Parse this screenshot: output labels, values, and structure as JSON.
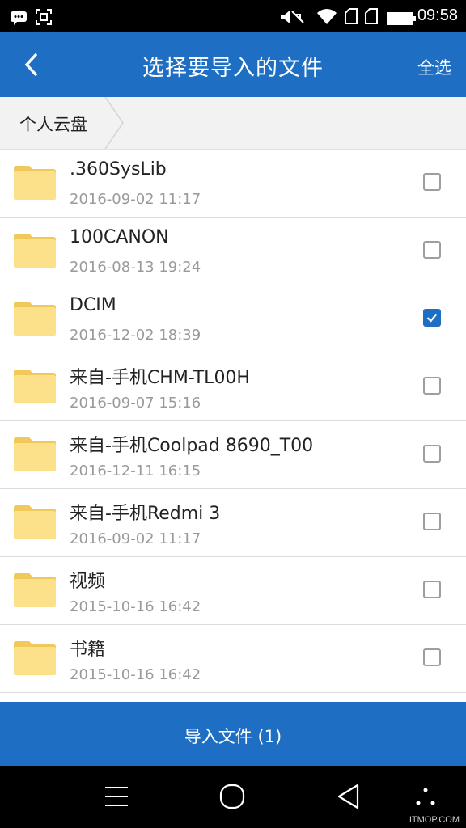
{
  "status_bar": {
    "time": "09:58",
    "icons": [
      "message-icon",
      "screenshot-icon",
      "mute-icon",
      "wifi-icon",
      "sim1-icon",
      "sim2-icon",
      "battery-icon"
    ]
  },
  "app_bar": {
    "title": "选择要导入的文件",
    "select_all": "全选",
    "back_icon": "back-arrow-icon"
  },
  "breadcrumb": {
    "items": [
      "个人云盘"
    ]
  },
  "files": [
    {
      "name": ".360SysLib",
      "date": "2016-09-02 11:17",
      "checked": false
    },
    {
      "name": "100CANON",
      "date": "2016-08-13 19:24",
      "checked": false
    },
    {
      "name": "DCIM",
      "date": "2016-12-02 18:39",
      "checked": true
    },
    {
      "name": "来自-手机CHM-TL00H",
      "date": "2016-09-07 15:16",
      "checked": false
    },
    {
      "name": "来自-手机Coolpad 8690_T00",
      "date": "2016-12-11 16:15",
      "checked": false
    },
    {
      "name": "来自-手机Redmi 3",
      "date": "2016-09-02 11:17",
      "checked": false
    },
    {
      "name": "视频",
      "date": "2015-10-16 16:42",
      "checked": false
    },
    {
      "name": "书籍",
      "date": "2015-10-16 16:42",
      "checked": false
    }
  ],
  "import_button": "导入文件 (1)",
  "nav_bar": {
    "icons": [
      "menu-icon",
      "home-icon",
      "back-icon",
      "more-icon"
    ]
  },
  "watermark": "ITMOP.COM",
  "colors": {
    "primary": "#1e6fc3",
    "folder": "#fce08a",
    "folder_edge": "#f0c95a"
  }
}
